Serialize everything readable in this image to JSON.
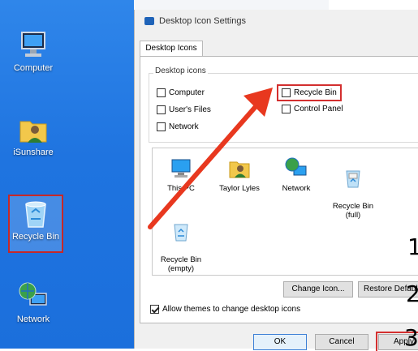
{
  "desktop": {
    "icons": [
      {
        "label": "Computer"
      },
      {
        "label": "iSunshare"
      },
      {
        "label": "Recycle Bin"
      },
      {
        "label": "Network"
      }
    ]
  },
  "dialog": {
    "title": "Desktop Icon Settings",
    "tab": "Desktop Icons",
    "group_label": "Desktop icons",
    "checkboxes": [
      {
        "label": "Computer",
        "checked": false
      },
      {
        "label": "User's Files",
        "checked": false
      },
      {
        "label": "Network",
        "checked": false
      },
      {
        "label": "Recycle Bin",
        "checked": false
      },
      {
        "label": "Control Panel",
        "checked": false
      }
    ],
    "preview_icons": [
      {
        "label": "This PC"
      },
      {
        "label": "Taylor Lyles"
      },
      {
        "label": "Network"
      },
      {
        "label": "Recycle Bin\n(full)"
      },
      {
        "label": "Recycle Bin\n(empty)"
      }
    ],
    "change_icon": "Change Icon...",
    "restore_default": "Restore Default",
    "allow_themes": {
      "label": "Allow themes to change desktop icons",
      "checked": true
    },
    "ok": "OK",
    "cancel": "Cancel",
    "apply": "Apply"
  },
  "steps": [
    "1",
    "2",
    "3"
  ],
  "colors": {
    "highlight": "#d32f2f",
    "desktop": "#1f74e0"
  }
}
